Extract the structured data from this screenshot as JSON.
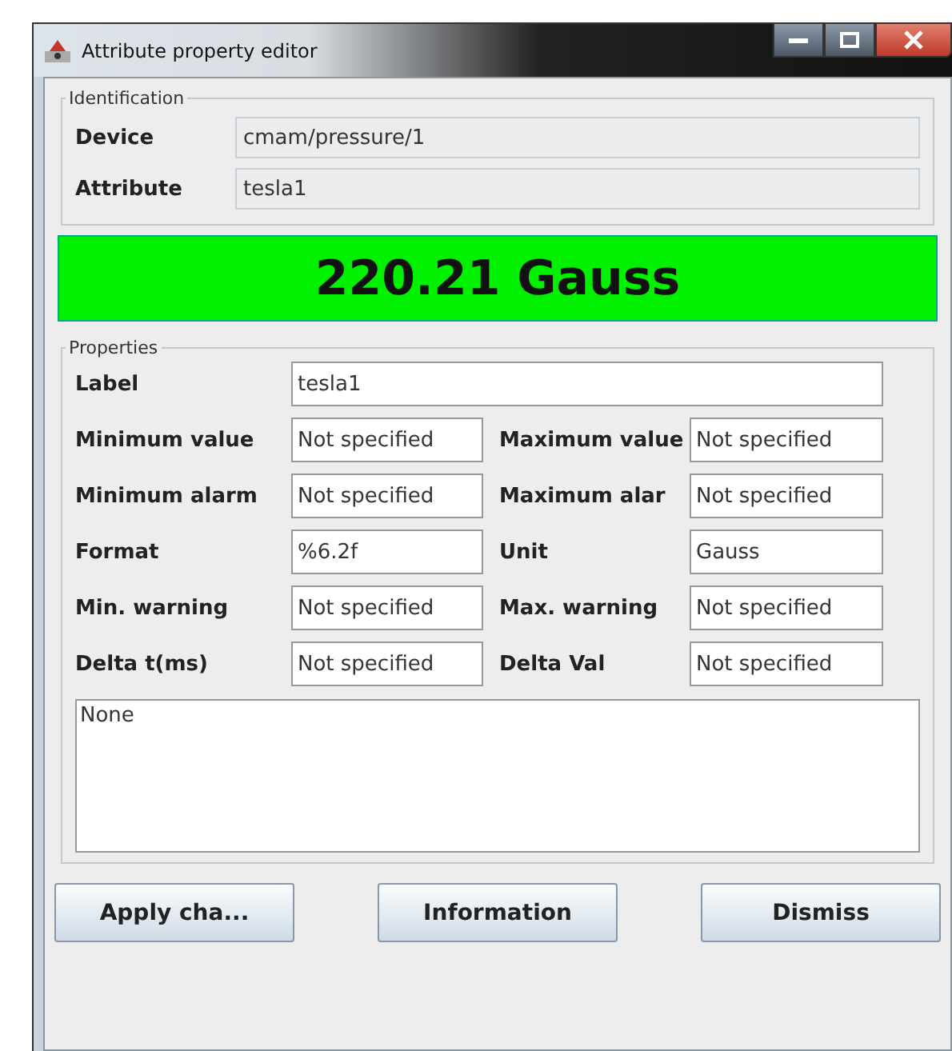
{
  "window": {
    "title": "Attribute property editor"
  },
  "identification": {
    "legend": "Identification",
    "fields": [
      {
        "label": "Device",
        "value": "cmam/pressure/1"
      },
      {
        "label": "Attribute",
        "value": "tesla1"
      }
    ]
  },
  "reading": {
    "value": "220.21 Gauss"
  },
  "properties": {
    "legend": "Properties",
    "label": {
      "label": "Label",
      "value": "tesla1"
    },
    "rows": [
      {
        "left": {
          "label": "Minimum value",
          "value": "Not specified"
        },
        "right": {
          "label": "Maximum value",
          "value": "Not specified"
        }
      },
      {
        "left": {
          "label": "Minimum alarm",
          "value": "Not specified"
        },
        "right": {
          "label": "Maximum alar",
          "value": "Not specified"
        }
      },
      {
        "left": {
          "label": "Format",
          "value": "%6.2f"
        },
        "right": {
          "label": "Unit",
          "value": "Gauss"
        }
      },
      {
        "left": {
          "label": "Min. warning",
          "value": "Not specified"
        },
        "right": {
          "label": "Max. warning",
          "value": "Not specified"
        }
      },
      {
        "left": {
          "label": "Delta t(ms)",
          "value": "Not specified"
        },
        "right": {
          "label": "Delta Val",
          "value": "Not specified"
        }
      }
    ],
    "description": "None"
  },
  "buttons": [
    "Apply cha...",
    "Information",
    "Dismiss"
  ]
}
